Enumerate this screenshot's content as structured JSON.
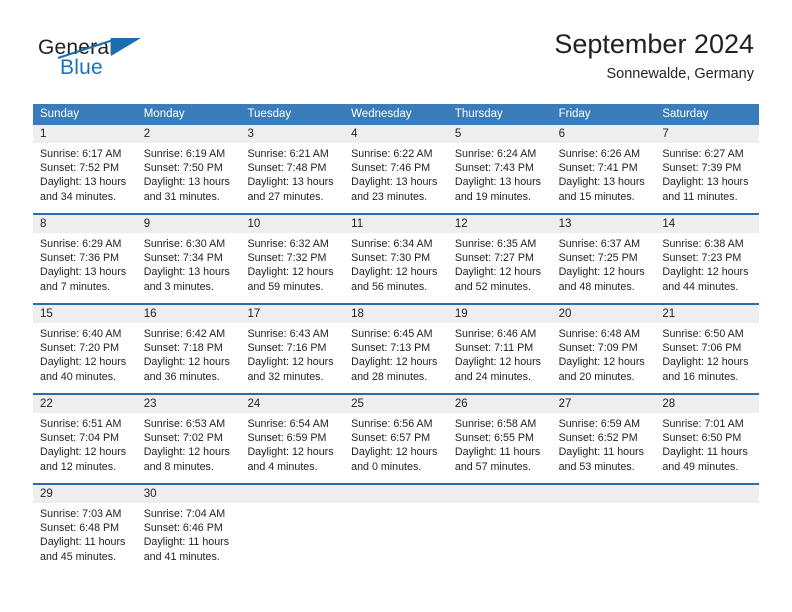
{
  "brand": {
    "word_one": "General",
    "word_two": "Blue",
    "logo_icon": "triangle-icon",
    "accent_color": "#1b6cb0"
  },
  "header": {
    "title": "September 2024",
    "subtitle": "Sonnewalde, Germany"
  },
  "colors": {
    "header_row_bg": "#3a7cb9",
    "week_separator": "#2b6da8",
    "day_band_bg": "#eeeeee",
    "text": "#231f20"
  },
  "weekdays": [
    "Sunday",
    "Monday",
    "Tuesday",
    "Wednesday",
    "Thursday",
    "Friday",
    "Saturday"
  ],
  "weeks": [
    [
      {
        "day": "1",
        "sunrise": "Sunrise: 6:17 AM",
        "sunset": "Sunset: 7:52 PM",
        "daylight_line1": "Daylight: 13 hours",
        "daylight_line2": "and 34 minutes."
      },
      {
        "day": "2",
        "sunrise": "Sunrise: 6:19 AM",
        "sunset": "Sunset: 7:50 PM",
        "daylight_line1": "Daylight: 13 hours",
        "daylight_line2": "and 31 minutes."
      },
      {
        "day": "3",
        "sunrise": "Sunrise: 6:21 AM",
        "sunset": "Sunset: 7:48 PM",
        "daylight_line1": "Daylight: 13 hours",
        "daylight_line2": "and 27 minutes."
      },
      {
        "day": "4",
        "sunrise": "Sunrise: 6:22 AM",
        "sunset": "Sunset: 7:46 PM",
        "daylight_line1": "Daylight: 13 hours",
        "daylight_line2": "and 23 minutes."
      },
      {
        "day": "5",
        "sunrise": "Sunrise: 6:24 AM",
        "sunset": "Sunset: 7:43 PM",
        "daylight_line1": "Daylight: 13 hours",
        "daylight_line2": "and 19 minutes."
      },
      {
        "day": "6",
        "sunrise": "Sunrise: 6:26 AM",
        "sunset": "Sunset: 7:41 PM",
        "daylight_line1": "Daylight: 13 hours",
        "daylight_line2": "and 15 minutes."
      },
      {
        "day": "7",
        "sunrise": "Sunrise: 6:27 AM",
        "sunset": "Sunset: 7:39 PM",
        "daylight_line1": "Daylight: 13 hours",
        "daylight_line2": "and 11 minutes."
      }
    ],
    [
      {
        "day": "8",
        "sunrise": "Sunrise: 6:29 AM",
        "sunset": "Sunset: 7:36 PM",
        "daylight_line1": "Daylight: 13 hours",
        "daylight_line2": "and 7 minutes."
      },
      {
        "day": "9",
        "sunrise": "Sunrise: 6:30 AM",
        "sunset": "Sunset: 7:34 PM",
        "daylight_line1": "Daylight: 13 hours",
        "daylight_line2": "and 3 minutes."
      },
      {
        "day": "10",
        "sunrise": "Sunrise: 6:32 AM",
        "sunset": "Sunset: 7:32 PM",
        "daylight_line1": "Daylight: 12 hours",
        "daylight_line2": "and 59 minutes."
      },
      {
        "day": "11",
        "sunrise": "Sunrise: 6:34 AM",
        "sunset": "Sunset: 7:30 PM",
        "daylight_line1": "Daylight: 12 hours",
        "daylight_line2": "and 56 minutes."
      },
      {
        "day": "12",
        "sunrise": "Sunrise: 6:35 AM",
        "sunset": "Sunset: 7:27 PM",
        "daylight_line1": "Daylight: 12 hours",
        "daylight_line2": "and 52 minutes."
      },
      {
        "day": "13",
        "sunrise": "Sunrise: 6:37 AM",
        "sunset": "Sunset: 7:25 PM",
        "daylight_line1": "Daylight: 12 hours",
        "daylight_line2": "and 48 minutes."
      },
      {
        "day": "14",
        "sunrise": "Sunrise: 6:38 AM",
        "sunset": "Sunset: 7:23 PM",
        "daylight_line1": "Daylight: 12 hours",
        "daylight_line2": "and 44 minutes."
      }
    ],
    [
      {
        "day": "15",
        "sunrise": "Sunrise: 6:40 AM",
        "sunset": "Sunset: 7:20 PM",
        "daylight_line1": "Daylight: 12 hours",
        "daylight_line2": "and 40 minutes."
      },
      {
        "day": "16",
        "sunrise": "Sunrise: 6:42 AM",
        "sunset": "Sunset: 7:18 PM",
        "daylight_line1": "Daylight: 12 hours",
        "daylight_line2": "and 36 minutes."
      },
      {
        "day": "17",
        "sunrise": "Sunrise: 6:43 AM",
        "sunset": "Sunset: 7:16 PM",
        "daylight_line1": "Daylight: 12 hours",
        "daylight_line2": "and 32 minutes."
      },
      {
        "day": "18",
        "sunrise": "Sunrise: 6:45 AM",
        "sunset": "Sunset: 7:13 PM",
        "daylight_line1": "Daylight: 12 hours",
        "daylight_line2": "and 28 minutes."
      },
      {
        "day": "19",
        "sunrise": "Sunrise: 6:46 AM",
        "sunset": "Sunset: 7:11 PM",
        "daylight_line1": "Daylight: 12 hours",
        "daylight_line2": "and 24 minutes."
      },
      {
        "day": "20",
        "sunrise": "Sunrise: 6:48 AM",
        "sunset": "Sunset: 7:09 PM",
        "daylight_line1": "Daylight: 12 hours",
        "daylight_line2": "and 20 minutes."
      },
      {
        "day": "21",
        "sunrise": "Sunrise: 6:50 AM",
        "sunset": "Sunset: 7:06 PM",
        "daylight_line1": "Daylight: 12 hours",
        "daylight_line2": "and 16 minutes."
      }
    ],
    [
      {
        "day": "22",
        "sunrise": "Sunrise: 6:51 AM",
        "sunset": "Sunset: 7:04 PM",
        "daylight_line1": "Daylight: 12 hours",
        "daylight_line2": "and 12 minutes."
      },
      {
        "day": "23",
        "sunrise": "Sunrise: 6:53 AM",
        "sunset": "Sunset: 7:02 PM",
        "daylight_line1": "Daylight: 12 hours",
        "daylight_line2": "and 8 minutes."
      },
      {
        "day": "24",
        "sunrise": "Sunrise: 6:54 AM",
        "sunset": "Sunset: 6:59 PM",
        "daylight_line1": "Daylight: 12 hours",
        "daylight_line2": "and 4 minutes."
      },
      {
        "day": "25",
        "sunrise": "Sunrise: 6:56 AM",
        "sunset": "Sunset: 6:57 PM",
        "daylight_line1": "Daylight: 12 hours",
        "daylight_line2": "and 0 minutes."
      },
      {
        "day": "26",
        "sunrise": "Sunrise: 6:58 AM",
        "sunset": "Sunset: 6:55 PM",
        "daylight_line1": "Daylight: 11 hours",
        "daylight_line2": "and 57 minutes."
      },
      {
        "day": "27",
        "sunrise": "Sunrise: 6:59 AM",
        "sunset": "Sunset: 6:52 PM",
        "daylight_line1": "Daylight: 11 hours",
        "daylight_line2": "and 53 minutes."
      },
      {
        "day": "28",
        "sunrise": "Sunrise: 7:01 AM",
        "sunset": "Sunset: 6:50 PM",
        "daylight_line1": "Daylight: 11 hours",
        "daylight_line2": "and 49 minutes."
      }
    ],
    [
      {
        "day": "29",
        "sunrise": "Sunrise: 7:03 AM",
        "sunset": "Sunset: 6:48 PM",
        "daylight_line1": "Daylight: 11 hours",
        "daylight_line2": "and 45 minutes."
      },
      {
        "day": "30",
        "sunrise": "Sunrise: 7:04 AM",
        "sunset": "Sunset: 6:46 PM",
        "daylight_line1": "Daylight: 11 hours",
        "daylight_line2": "and 41 minutes."
      },
      {
        "day": "",
        "sunrise": "",
        "sunset": "",
        "daylight_line1": "",
        "daylight_line2": ""
      },
      {
        "day": "",
        "sunrise": "",
        "sunset": "",
        "daylight_line1": "",
        "daylight_line2": ""
      },
      {
        "day": "",
        "sunrise": "",
        "sunset": "",
        "daylight_line1": "",
        "daylight_line2": ""
      },
      {
        "day": "",
        "sunrise": "",
        "sunset": "",
        "daylight_line1": "",
        "daylight_line2": ""
      },
      {
        "day": "",
        "sunrise": "",
        "sunset": "",
        "daylight_line1": "",
        "daylight_line2": ""
      }
    ]
  ]
}
